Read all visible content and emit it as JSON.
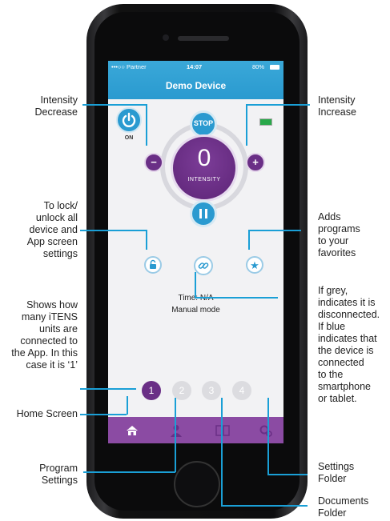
{
  "annotations": {
    "intensity_decrease": "Intensity\nDecrease",
    "intensity_increase": "Intensity\nIncrease",
    "lock": "To lock/\nunlock all\ndevice and\nApp screen\nsettings",
    "favorites": "Adds\nprograms\nto your\nfavorites",
    "units": "Shows how\nmany iTENS\nunits are\nconnected to\nthe App. In this\ncase it is ‘1’",
    "connection": "If grey,\nindicates it is\ndisconnected.\nIf blue\nindicates that\nthe device is\nconnected\nto the\nsmartphone\nor tablet.",
    "home": "Home Screen",
    "program": "Program\nSettings",
    "settings": "Settings\nFolder",
    "documents": "Documents\nFolder"
  },
  "status_bar": {
    "carrier": "•••○○ Partner",
    "time": "14:07",
    "battery": "80%"
  },
  "app": {
    "title": "Demo Device",
    "power_label": "ON",
    "stop_label": "STOP",
    "intensity_value": "0",
    "intensity_label": "INTENSITY",
    "time_text": "Time: N/A",
    "mode_text": "Manual mode",
    "units": [
      "1",
      "2",
      "3",
      "4"
    ],
    "active_unit": "1"
  },
  "colors": {
    "accent_blue": "#2a9ad0",
    "purple": "#6a2f86",
    "tabbar": "#8b4ba3",
    "line": "#1a9fd6"
  },
  "tabs": [
    "home-icon",
    "user-icon",
    "book-icon",
    "gears-icon"
  ]
}
